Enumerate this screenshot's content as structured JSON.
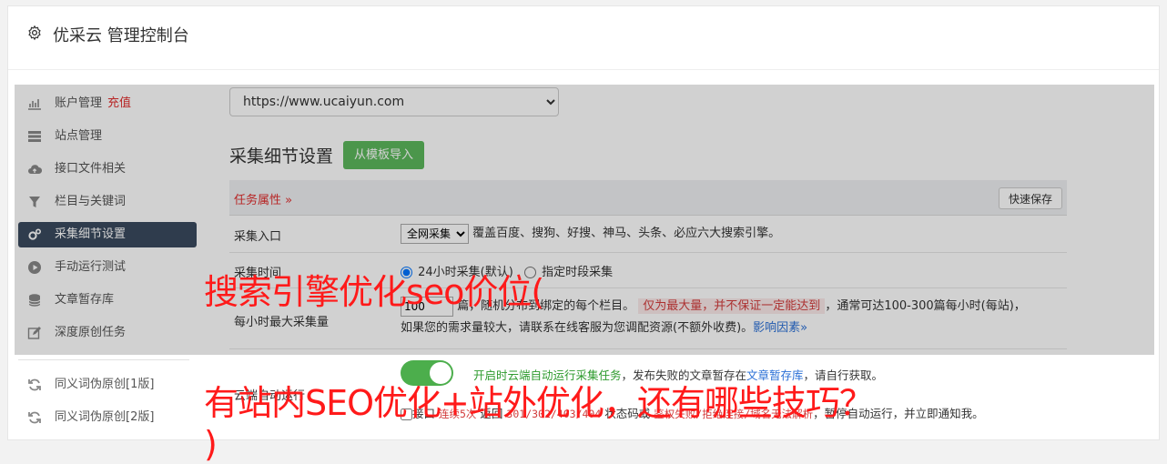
{
  "header": {
    "title": "优采云 管理控制台",
    "icon": "gear-icon"
  },
  "sidebar": {
    "items": [
      {
        "label": "账户管理",
        "tag": "充值",
        "icon": "bar-chart-icon"
      },
      {
        "label": "站点管理",
        "icon": "server-icon"
      },
      {
        "label": "接口文件相关",
        "icon": "cloud-upload-icon"
      },
      {
        "label": "栏目与关键词",
        "icon": "filter-icon"
      },
      {
        "label": "采集细节设置",
        "icon": "gears-icon",
        "active": true
      },
      {
        "label": "手动运行测试",
        "icon": "play-circle-icon"
      },
      {
        "label": "文章暂存库",
        "icon": "database-icon"
      },
      {
        "label": "深度原创任务",
        "icon": "edit-icon"
      },
      {
        "label": "同义词伪原创[1版]",
        "icon": "refresh-icon"
      },
      {
        "label": "同义词伪原创[2版]",
        "icon": "refresh-icon"
      }
    ]
  },
  "main": {
    "site_select": "https://www.ucaiyun.com",
    "section_title": "采集细节设置",
    "import_button": "从模板导入",
    "table": {
      "task_attr": "任务属性",
      "quick_save": "快速保存",
      "rows": {
        "entry": {
          "label": "采集入口",
          "select": "全网采集",
          "desc": "覆盖百度、搜狗、好搜、神马、头条、必应六大搜索引擎。"
        },
        "time": {
          "label": "采集时间",
          "opt1": "24小时采集(默认)",
          "opt2": "指定时段采集"
        },
        "max": {
          "label": "每小时最大采集量",
          "value": "100",
          "text1": "篇，随机分布到绑定的每个栏目。",
          "warn": "仅为最大量，并不保证一定能达到",
          "text2": "，通常可达100-300篇每小时(每站)，",
          "text3": "如果您的需求量较大，请联系在线客服为您调配资源(不额外收费)。",
          "link": "影响因素"
        },
        "auto": {
          "label": "云端自动运行",
          "green": "开启时云端自动运行采集任务",
          "text1": "，发布失败的文章暂存在",
          "link": "文章暂存库",
          "text2": "，请自行获取。",
          "cb_label": "接口",
          "red1": "连续5次",
          "text3": "返回",
          "codes": "301/302/403/404",
          "text4": "状态码或",
          "codes2": "鉴权失败/拒绝连接/域名无法解析",
          "text5": "，暂停自动运行，并立即通知我。"
        }
      }
    }
  },
  "overlay_text": {
    "line1": "搜索引擎优化seo价位(",
    "line2": "有站内SEO优化+站外优化，还有哪些技巧？",
    "line3": ")"
  },
  "colors": {
    "accent_red": "#e02e2e",
    "nav_active": "#3a4a5e",
    "green_btn": "#5cb85c",
    "overlay_text": "#ff1a1a"
  }
}
